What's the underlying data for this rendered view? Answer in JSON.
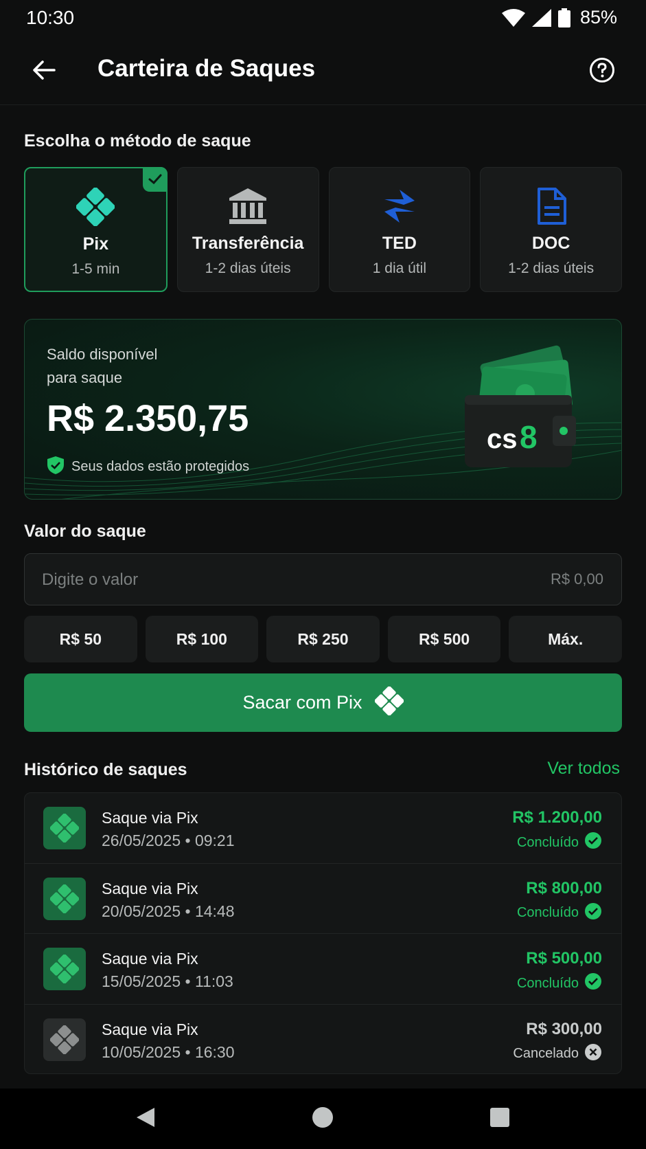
{
  "status_bar": {
    "time": "10:30",
    "battery": "85%"
  },
  "header": {
    "title": "Carteira de Saques"
  },
  "methods_section": {
    "title": "Escolha o método de saque",
    "items": [
      {
        "name": "Pix",
        "time": "1-5 min",
        "icon": "pix-icon",
        "selected": true
      },
      {
        "name": "Transferência",
        "time": "1-2 dias úteis",
        "icon": "bank-icon",
        "selected": false
      },
      {
        "name": "TED",
        "time": "1 dia útil",
        "icon": "ted-icon",
        "selected": false
      },
      {
        "name": "DOC",
        "time": "1-2 dias úteis",
        "icon": "document-icon",
        "selected": false
      }
    ]
  },
  "balance": {
    "label_line1": "Saldo disponível",
    "label_line2": "para saque",
    "value": "R$ 2.350,75",
    "secure_text": "Seus dados estão protegidos",
    "wallet_logo_a": "cs",
    "wallet_logo_b": "8"
  },
  "amount_section": {
    "title": "Valor do saque",
    "placeholder": "Digite o valor",
    "currency_hint": "R$ 0,00",
    "quick": [
      "R$ 50",
      "R$ 100",
      "R$ 250",
      "R$ 500",
      "Máx."
    ]
  },
  "withdraw_button": {
    "label": "Sacar com Pix"
  },
  "history": {
    "title": "Histórico de saques",
    "see_all": "Ver todos",
    "rows": [
      {
        "title": "Saque via Pix",
        "date": "26/05/2025 • 09:21",
        "amount": "R$ 1.200,00",
        "status": "Concluído",
        "state": "done"
      },
      {
        "title": "Saque via Pix",
        "date": "20/05/2025 • 14:48",
        "amount": "R$ 800,00",
        "status": "Concluído",
        "state": "done"
      },
      {
        "title": "Saque via Pix",
        "date": "15/05/2025 • 11:03",
        "amount": "R$ 500,00",
        "status": "Concluído",
        "state": "done"
      },
      {
        "title": "Saque via Pix",
        "date": "10/05/2025 • 16:30",
        "amount": "R$ 300,00",
        "status": "Cancelado",
        "state": "cancelled"
      }
    ]
  },
  "colors": {
    "accent": "#1f9d5c",
    "success_text": "#22c565",
    "pix_teal": "#2ed3b7",
    "blue": "#1f5fd6",
    "background": "#0e0f0f"
  }
}
